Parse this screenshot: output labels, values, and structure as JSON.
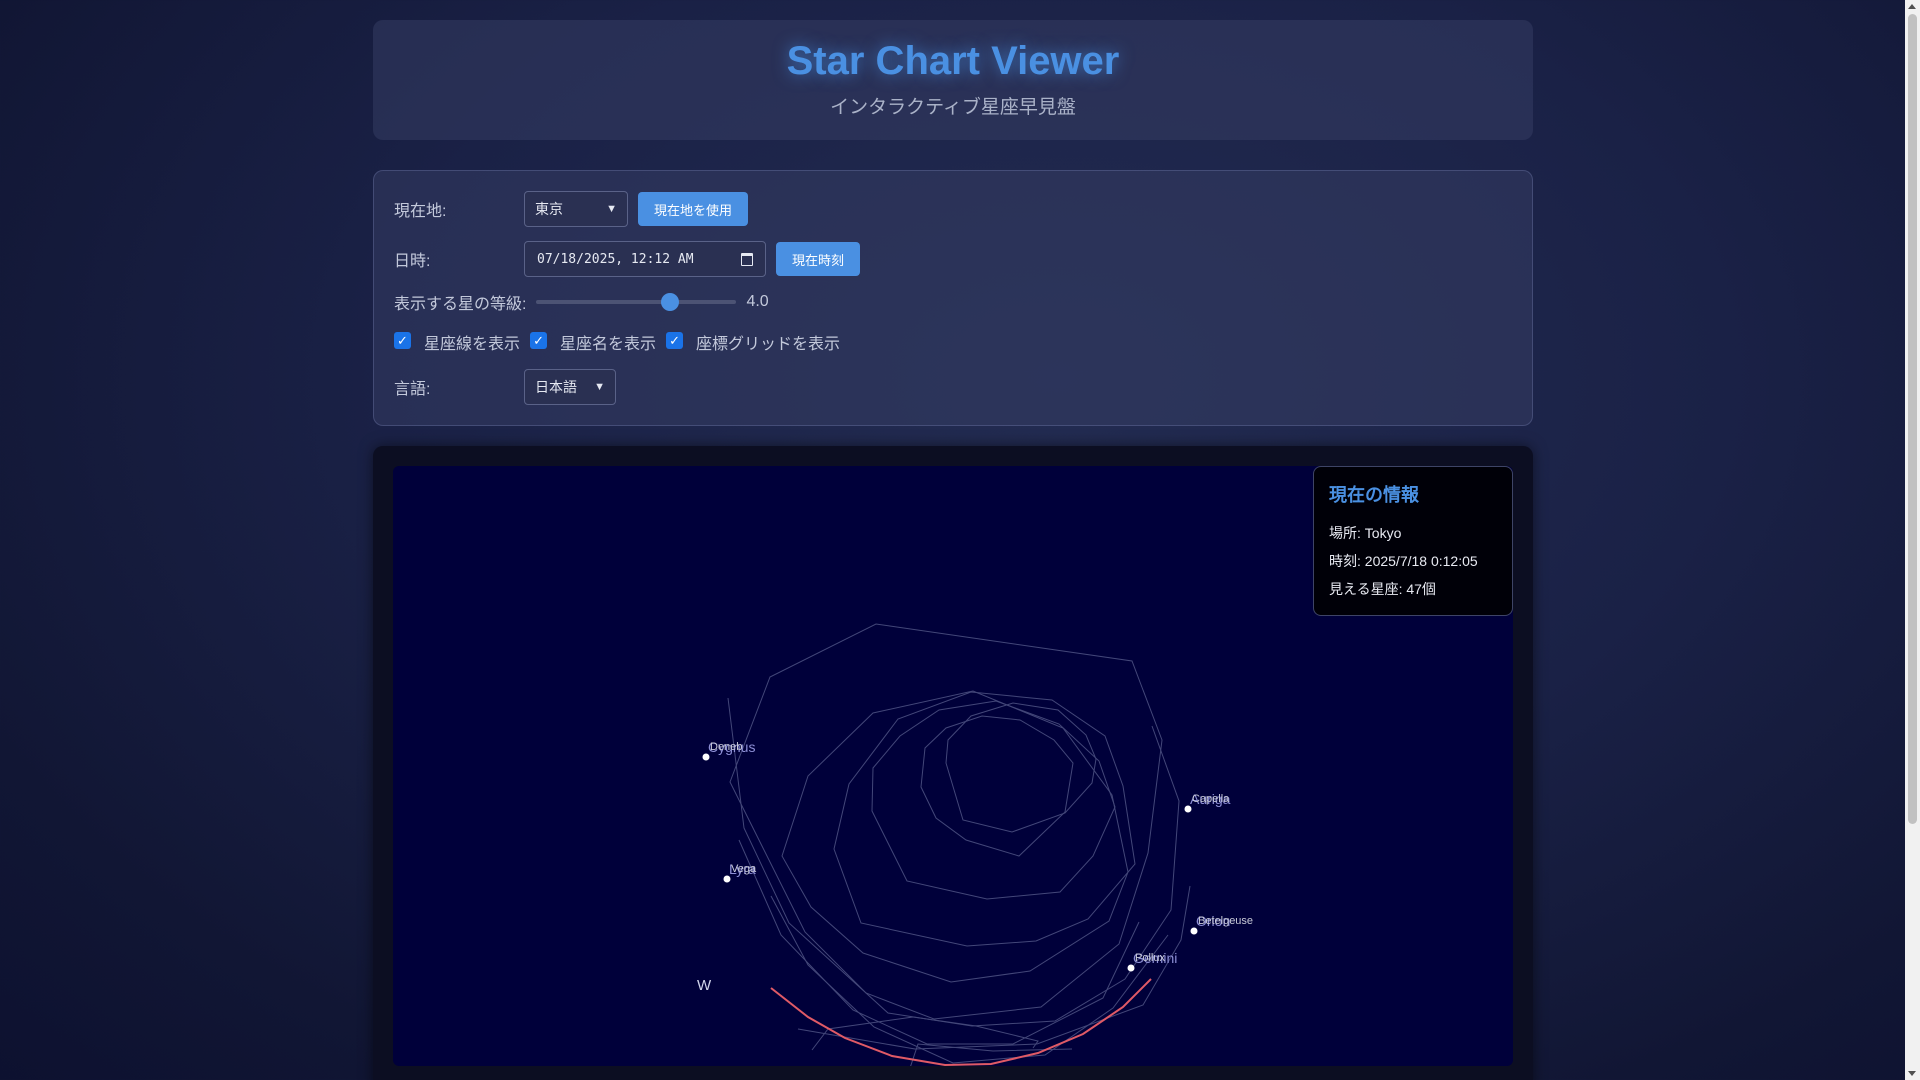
{
  "header": {
    "title": "Star Chart Viewer",
    "subtitle": "インタラクティブ星座早見盤"
  },
  "controls": {
    "location_label": "現在地:",
    "location_value": "東京",
    "use_location_button": "現在地を使用",
    "datetime_label": "日時:",
    "datetime_value": "07/18/2025, 12:12 AM",
    "now_button": "現在時刻",
    "magnitude_label": "表示する星の等級:",
    "magnitude_value": "4.0",
    "magnitude_range": [
      0,
      6
    ],
    "checkboxes": [
      {
        "label": "星座線を表示",
        "checked": true
      },
      {
        "label": "星座名を表示",
        "checked": true
      },
      {
        "label": "座標グリッドを表示",
        "checked": true
      }
    ],
    "language_label": "言語:",
    "language_value": "日本語"
  },
  "info_panel": {
    "title": "現在の情報",
    "location": "場所: Tokyo",
    "time": "時刻: 2025/7/18 0:12:05",
    "visible": "見える星座: 47個"
  },
  "sky": {
    "direction_label": "W",
    "stars": [
      {
        "star": "Deneb",
        "constellation": "Cygnus"
      },
      {
        "star": "Vega",
        "constellation": "Lyra"
      },
      {
        "star": "Capella",
        "constellation": "Auriga"
      },
      {
        "star": "Betelgeuse",
        "constellation": "Orion"
      },
      {
        "star": "Pollux",
        "constellation": "Gemini"
      }
    ]
  },
  "colors": {
    "accent": "#4a90e2",
    "horizon": "#e05a66",
    "sky_background": "#00003a"
  }
}
